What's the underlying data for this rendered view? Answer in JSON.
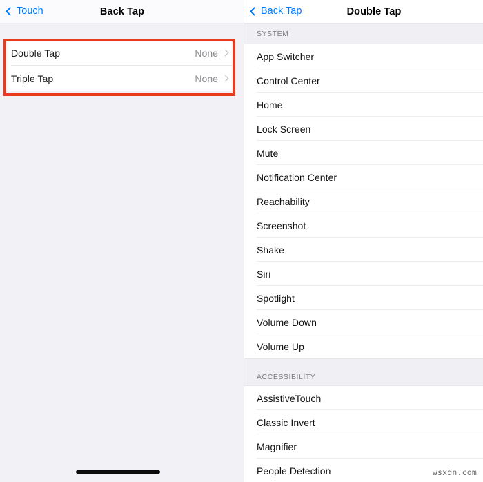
{
  "left_panel": {
    "nav": {
      "back_label": "Touch",
      "title": "Back Tap",
      "back_icon": "chevron-left-icon"
    },
    "highlight_color": "#ea3a1d",
    "rows": [
      {
        "label": "Double Tap",
        "value": "None",
        "chevron": "chevron-right-icon"
      },
      {
        "label": "Triple Tap",
        "value": "None",
        "chevron": "chevron-right-icon"
      }
    ]
  },
  "right_panel": {
    "nav": {
      "back_label": "Back Tap",
      "title": "Double Tap",
      "back_icon": "chevron-left-icon"
    },
    "sections": [
      {
        "header": "SYSTEM",
        "items": [
          "App Switcher",
          "Control Center",
          "Home",
          "Lock Screen",
          "Mute",
          "Notification Center",
          "Reachability",
          "Screenshot",
          "Shake",
          "Siri",
          "Spotlight",
          "Volume Down",
          "Volume Up"
        ]
      },
      {
        "header": "ACCESSIBILITY",
        "items": [
          "AssistiveTouch",
          "Classic Invert",
          "Magnifier",
          "People Detection"
        ]
      }
    ]
  },
  "overlay": {
    "watermark": "wsxdn.com",
    "home_indicator_left": "home-indicator",
    "home_indicator_right": "home-indicator"
  },
  "colors": {
    "accent_blue": "#007aff",
    "highlight_red": "#ea3a1d",
    "group_bg": "#efeff4",
    "page_bg": "#f1f1f6"
  }
}
